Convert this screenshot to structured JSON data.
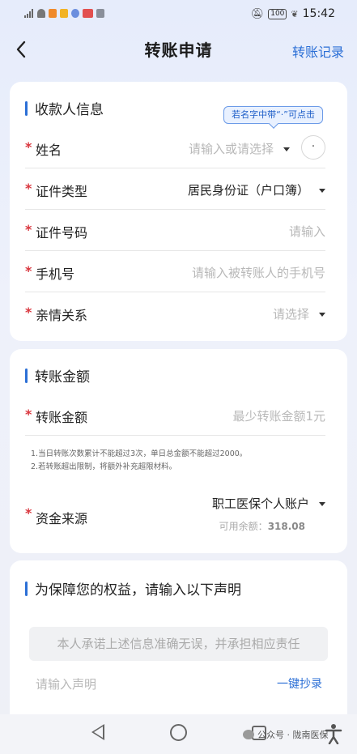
{
  "status_bar": {
    "time": "15:42",
    "battery": "100"
  },
  "header": {
    "title": "转账申请",
    "records_link": "转账记录"
  },
  "payee_card": {
    "title": "收款人信息",
    "hint": "若名字中带“·”可点击",
    "name": {
      "label": "姓名",
      "placeholder": "请输入或请选择",
      "dot": "·"
    },
    "id_type": {
      "label": "证件类型",
      "value": "居民身份证（户口簿）"
    },
    "id_number": {
      "label": "证件号码",
      "placeholder": "请输入"
    },
    "phone": {
      "label": "手机号",
      "placeholder": "请输入被转账人的手机号"
    },
    "relation": {
      "label": "亲情关系",
      "placeholder": "请选择"
    }
  },
  "amount_card": {
    "title": "转账金额",
    "amount": {
      "label": "转账金额",
      "placeholder": "最少转账金额1元"
    },
    "rules": [
      "1.当日转账次数累计不能超过3次，单日总金额不能超过2000。",
      "2.若转账超出限制，将额外补充超限材料。"
    ],
    "source": {
      "label": "资金来源",
      "value": "职工医保个人账户"
    },
    "balance_label": "可用余额：",
    "balance_value": "318.08"
  },
  "statement_card": {
    "title": "为保障您的权益，请输入以下声明",
    "statement_text": "本人承诺上述信息准确无误，并承担相应责任",
    "input_placeholder": "请输入声明",
    "copy_button": "一键抄录"
  },
  "watermark": "公众号 · 陇南医保",
  "colors": {
    "accent": "#2b6fd6",
    "required": "#d9363e",
    "background": "#e9edf8"
  }
}
